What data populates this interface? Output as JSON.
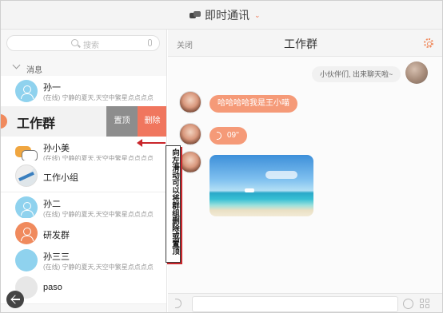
{
  "app": {
    "title": "即时通讯",
    "title_chevron": "⌄"
  },
  "left_panel": {
    "search_placeholder": "搜索",
    "section_label": "消息",
    "items": [
      {
        "name": "孙一",
        "sub": "(在线) 宁静的夏天,天空中繁星点点点点",
        "avatar": "person"
      },
      {
        "name": "孙小美",
        "sub": "(在线) 宁静的夏天,天空中繁星点点点点",
        "avatar": "chat-bubble"
      },
      {
        "name": "工作小组",
        "sub": "",
        "avatar": "group"
      },
      {
        "name": "孙二",
        "sub": "(在线) 宁静的夏天,天空中繁星点点点点",
        "avatar": "person"
      },
      {
        "name": "研发群",
        "sub": "",
        "avatar": "orange-group"
      },
      {
        "name": "孙三三",
        "sub": "(在线) 宁静的夏天,天空中繁星点点点点",
        "avatar": "blue"
      },
      {
        "name": "paso",
        "sub": "",
        "avatar": "gray"
      }
    ],
    "swiped_item": {
      "name": "工作群",
      "pin_label": "置顶",
      "delete_label": "删除"
    }
  },
  "chat": {
    "close_label": "关闭",
    "title": "工作群",
    "messages": {
      "outgoing": "小伙伴们, 出来聊天啦~",
      "incoming_text": "哈哈哈哈我是王小喵",
      "incoming_voice": "09''"
    }
  },
  "annotation": {
    "text": "向左滑动可以将群组删除或置顶",
    "color": "#c9262b"
  },
  "colors": {
    "accent": "#f08a5d",
    "bubble_in": "#f59a78",
    "delete_bg": "#f0765e",
    "pin_bg": "#8d8d8d"
  }
}
